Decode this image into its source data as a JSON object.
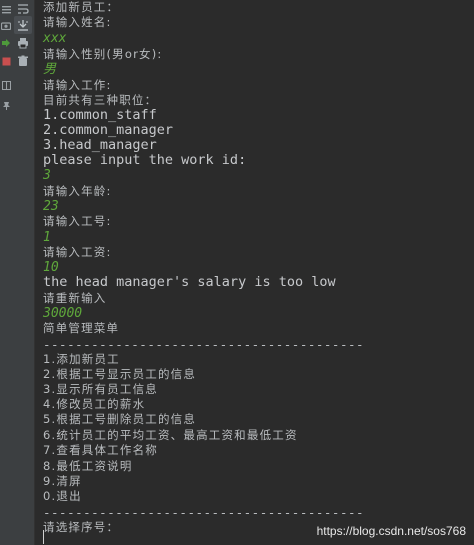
{
  "console": {
    "lines": [
      {
        "text": "添加新员工：",
        "kind": "cn"
      },
      {
        "text": "请输入姓名:",
        "kind": "cn"
      },
      {
        "text": "xxx",
        "kind": "input"
      },
      {
        "text": "请输入性别(男or女):",
        "kind": "cn"
      },
      {
        "text": "男",
        "kind": "input-cn"
      },
      {
        "text": "请输入工作:",
        "kind": "cn"
      },
      {
        "text": "目前共有三种职位：",
        "kind": "cn"
      },
      {
        "text": "1.common_staff",
        "kind": "en"
      },
      {
        "text": "2.common_manager",
        "kind": "en"
      },
      {
        "text": "3.head_manager",
        "kind": "en"
      },
      {
        "text": "please input the work id:",
        "kind": "en"
      },
      {
        "text": "3",
        "kind": "input"
      },
      {
        "text": "请输入年龄:",
        "kind": "cn"
      },
      {
        "text": "23",
        "kind": "input"
      },
      {
        "text": "请输入工号:",
        "kind": "cn"
      },
      {
        "text": "1",
        "kind": "input"
      },
      {
        "text": "请输入工资:",
        "kind": "cn"
      },
      {
        "text": "10",
        "kind": "input"
      },
      {
        "text": "the head manager's salary is too low",
        "kind": "en"
      },
      {
        "text": "请重新输入",
        "kind": "cn"
      },
      {
        "text": "30000",
        "kind": "input"
      },
      {
        "text": "简单管理菜单",
        "kind": "cn"
      },
      {
        "text": "----------------------------------------",
        "kind": "sep"
      },
      {
        "text": "1.添加新员工",
        "kind": "cn"
      },
      {
        "text": "2.根据工号显示员工的信息",
        "kind": "cn"
      },
      {
        "text": "3.显示所有员工信息",
        "kind": "cn"
      },
      {
        "text": "4.修改员工的薪水",
        "kind": "cn"
      },
      {
        "text": "5.根据工号删除员工的信息",
        "kind": "cn"
      },
      {
        "text": "6.统计员工的平均工资、最高工资和最低工资",
        "kind": "cn"
      },
      {
        "text": "7.查看具体工作名称",
        "kind": "cn"
      },
      {
        "text": "8.最低工资说明",
        "kind": "cn"
      },
      {
        "text": "9.清屏",
        "kind": "cn"
      },
      {
        "text": "0.退出",
        "kind": "cn"
      },
      {
        "text": "----------------------------------------",
        "kind": "sep"
      },
      {
        "text": "请选择序号：",
        "kind": "cn"
      }
    ]
  },
  "toolbar": {
    "buttons": [
      {
        "name": "soft-wrap-icon"
      },
      {
        "name": "scroll-to-end-icon"
      },
      {
        "name": "print-icon"
      },
      {
        "name": "clear-all-icon"
      }
    ],
    "left_buttons": [
      {
        "name": "menu-icon"
      },
      {
        "name": "camera-icon"
      },
      {
        "name": "rerun-icon"
      },
      {
        "name": "stop-icon"
      },
      {
        "name": "layout-icon"
      },
      {
        "name": "pin-icon"
      }
    ]
  },
  "watermark": "https://blog.csdn.net/sos768",
  "colors": {
    "background": "#2b2b2b",
    "gutter": "#3c3f41",
    "text": "#b9bcbf",
    "input": "#5fa83b"
  }
}
